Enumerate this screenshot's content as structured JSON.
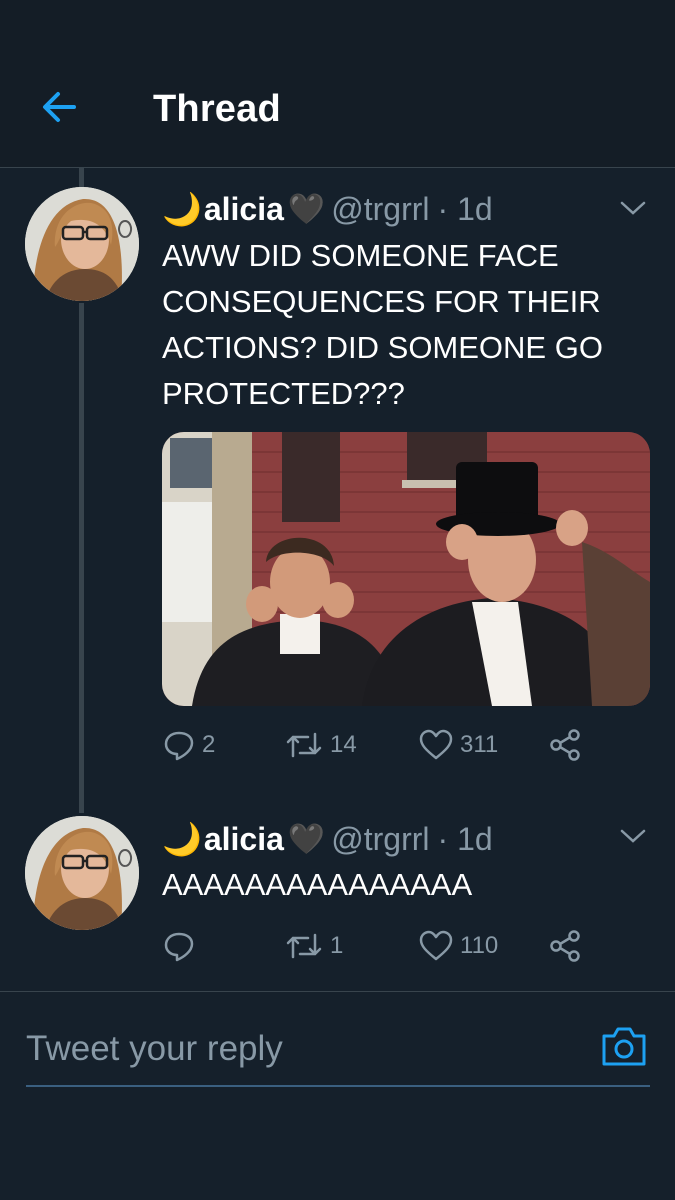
{
  "header": {
    "title": "Thread"
  },
  "tweets": [
    {
      "moon": "🌙",
      "name": "alicia",
      "heart": "🖤",
      "handle": "@trgrrl",
      "time": "· 1d",
      "text": "AWW DID SOMEONE FACE CONSEQUENCES FOR THEIR ACTIONS? DID SOMEONE GO PROTECTED???",
      "replies": "2",
      "retweets": "14",
      "likes": "311"
    },
    {
      "moon": "🌙",
      "name": "alicia",
      "heart": "🖤",
      "handle": "@trgrrl",
      "time": "· 1d",
      "text": "AAAAAAAAAAAAAAA",
      "replies": "",
      "retweets": "1",
      "likes": "110"
    }
  ],
  "reply": {
    "placeholder": "Tweet your reply"
  },
  "colors": {
    "background": "#15202b",
    "header": "#141d26",
    "accent": "#1da1f2",
    "secondary_text": "#8899a6",
    "divider": "#38444d"
  },
  "icons": [
    "back-arrow-icon",
    "chevron-down-icon",
    "reply-icon",
    "retweet-icon",
    "like-icon",
    "share-icon",
    "camera-icon"
  ]
}
